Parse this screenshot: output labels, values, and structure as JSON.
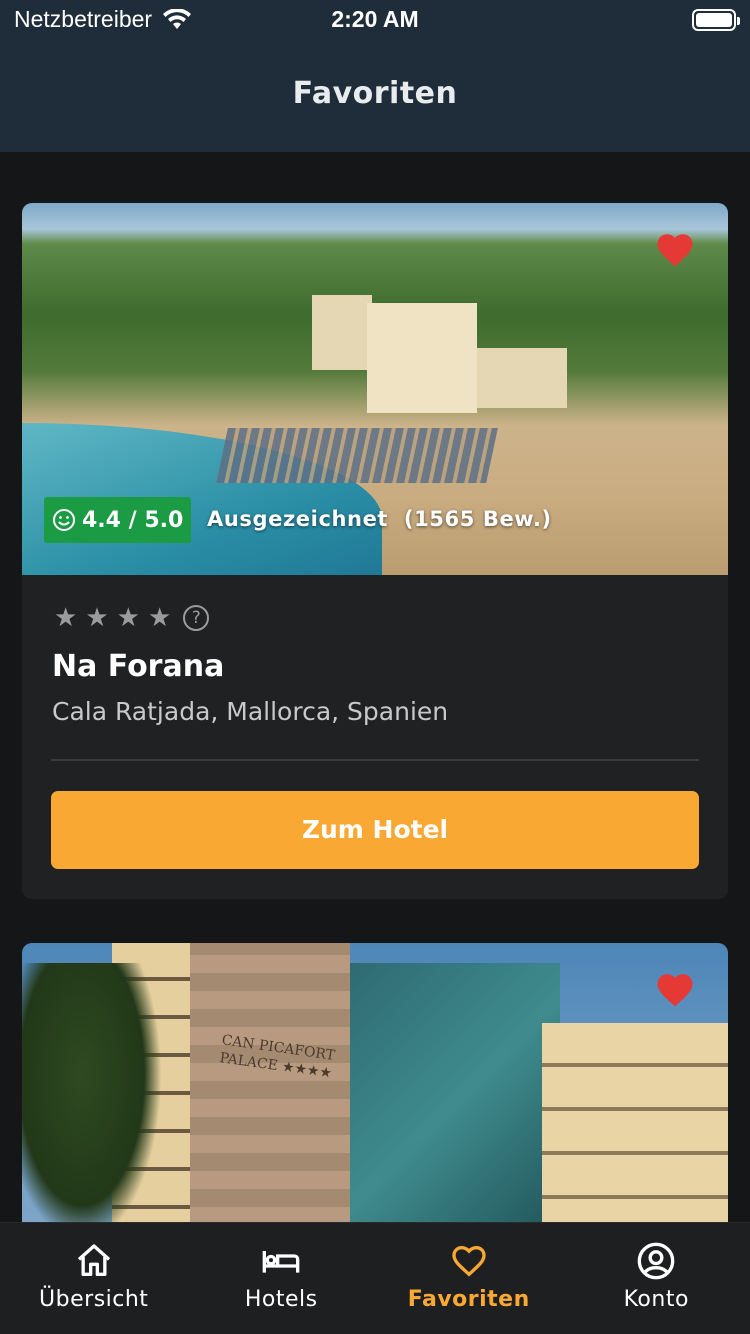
{
  "status_bar": {
    "carrier": "Netzbetreiber",
    "time": "2:20 AM",
    "wifi_icon": "wifi-icon",
    "battery_icon": "battery-icon"
  },
  "header": {
    "title": "Favoriten"
  },
  "favorites": [
    {
      "rating": "4.4 / 5.0",
      "rating_label": "Ausgezeichnet  (1565 Bew.)",
      "stars": 4,
      "name": "Na Forana",
      "location": "Cala Ratjada, Mallorca, Spanien",
      "button_label": "Zum Hotel",
      "favorite_icon": "heart-filled-icon"
    },
    {
      "sign_text": "CAN PICAFORT PALACE ★★★★",
      "favorite_icon": "heart-filled-icon"
    }
  ],
  "tabs": [
    {
      "label": "Übersicht",
      "icon": "home-icon"
    },
    {
      "label": "Hotels",
      "icon": "bed-icon"
    },
    {
      "label": "Favoriten",
      "icon": "heart-outline-icon",
      "active": true
    },
    {
      "label": "Konto",
      "icon": "account-icon"
    }
  ],
  "colors": {
    "header_bg": "#1f2d3a",
    "accent": "#f9a834",
    "rating_badge": "#1c9b45",
    "heart": "#e53935",
    "card_bg": "#202122"
  }
}
